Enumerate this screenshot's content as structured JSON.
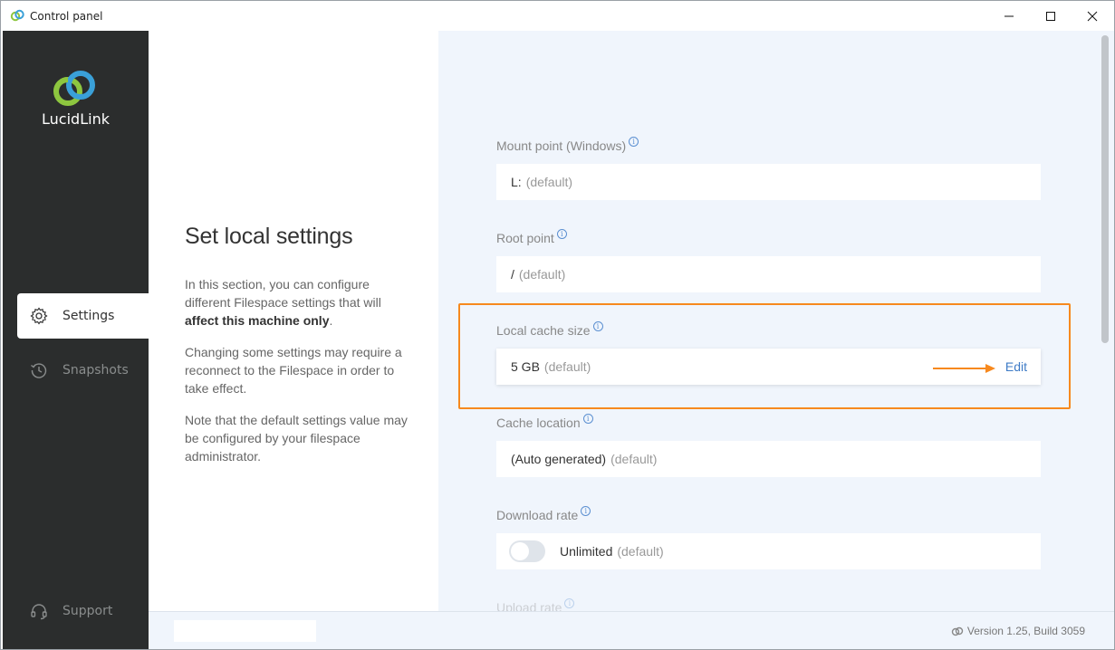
{
  "window": {
    "title": "Control panel"
  },
  "sidebar": {
    "brand": "LucidLink",
    "items": [
      {
        "label": "Settings",
        "icon": "gear-icon",
        "active": true
      },
      {
        "label": "Snapshots",
        "icon": "history-icon",
        "active": false
      },
      {
        "label": "Support",
        "icon": "headset-icon",
        "active": false
      }
    ]
  },
  "description": {
    "title": "Set local settings",
    "p1_start": "In this section, you can configure different Filespace settings that will ",
    "p1_bold": "affect this machine only",
    "p1_end": ".",
    "p2": "Changing some settings may require a reconnect to the Filespace in order to take effect.",
    "p3": "Note that the default settings value may be configured by your filespace administrator."
  },
  "fields": [
    {
      "label": "Mount point (Windows)",
      "value": "L:",
      "default": "(default)"
    },
    {
      "label": "Root point",
      "value": "/",
      "default": "(default)"
    },
    {
      "label": "Local cache size",
      "value": "5 GB",
      "default": "(default)",
      "action": "Edit"
    },
    {
      "label": "Cache location",
      "value": "(Auto generated)",
      "default": "(default)"
    },
    {
      "label": "Download rate",
      "value": "Unlimited",
      "default": "(default)",
      "toggle": false
    },
    {
      "label": "Upload rate"
    }
  ],
  "footer": {
    "version": "Version 1.25, Build 3059"
  },
  "colors": {
    "accent": "#3f7bc6",
    "highlight": "#f7891e",
    "sidebar": "#2b2d2d",
    "logo_green": "#8dc63f",
    "logo_blue": "#3aa0d8"
  }
}
